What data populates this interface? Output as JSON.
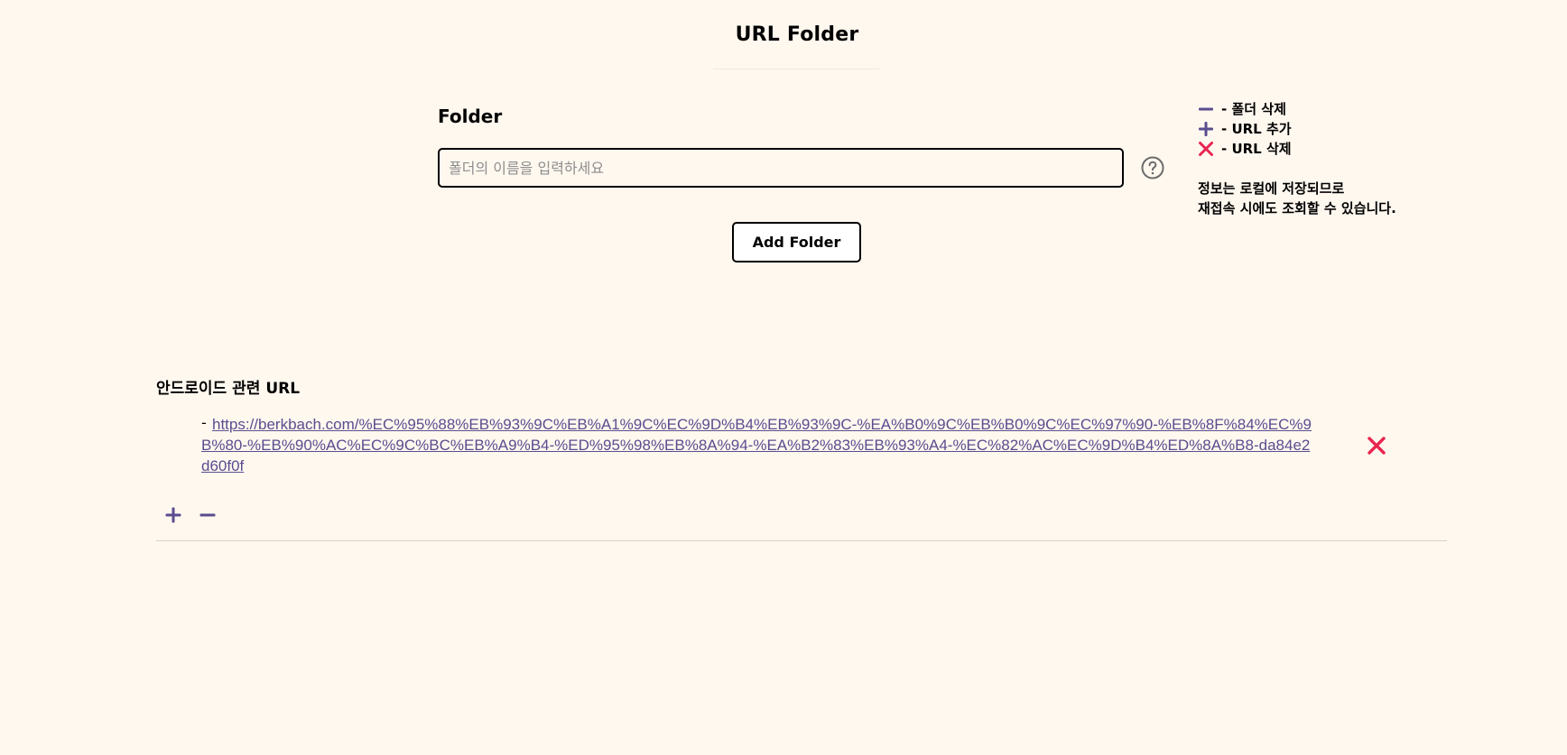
{
  "header": {
    "title": "URL Folder"
  },
  "form": {
    "folder_label": "Folder",
    "folder_input_placeholder": "폴더의 이름을 입력하세요",
    "folder_input_value": "",
    "help_icon": "question-circle-icon",
    "add_folder_label": "Add Folder"
  },
  "legend": {
    "items": [
      {
        "icon": "minus-icon",
        "text": "- 폴더 삭제"
      },
      {
        "icon": "plus-icon",
        "text": "- URL 추가"
      },
      {
        "icon": "close-icon",
        "text": "- URL 삭제"
      }
    ],
    "note_line1": "정보는 로컬에 저장되므로",
    "note_line2": "재접속 시에도 조회할 수 있습니다."
  },
  "folders": [
    {
      "name": "안드로이드 관련 URL",
      "urls": [
        {
          "prefix": "-",
          "href": "https://berkbach.com/%EC%95%88%EB%93%9C%EB%A1%9C%EC%9D%B4%EB%93%9C-%EA%B0%9C%EB%B0%9C%EC%97%90-%EB%8F%84%EC%9B%80-%EB%90%AC%EC%9C%BC%EB%A9%B4-%ED%95%98%EB%8A%94-%EA%B2%83%EB%93%A4-%EC%82%AC%EC%9D%B4%ED%8A%B8-da84e2d60f0f"
        }
      ],
      "actions": {
        "add_url_icon": "plus-icon",
        "delete_folder_icon": "minus-icon"
      }
    }
  ],
  "colors": {
    "background": "#fff8ef",
    "accent_purple": "#5a4d8f",
    "delete_red": "#e8254f",
    "border": "#000000"
  }
}
